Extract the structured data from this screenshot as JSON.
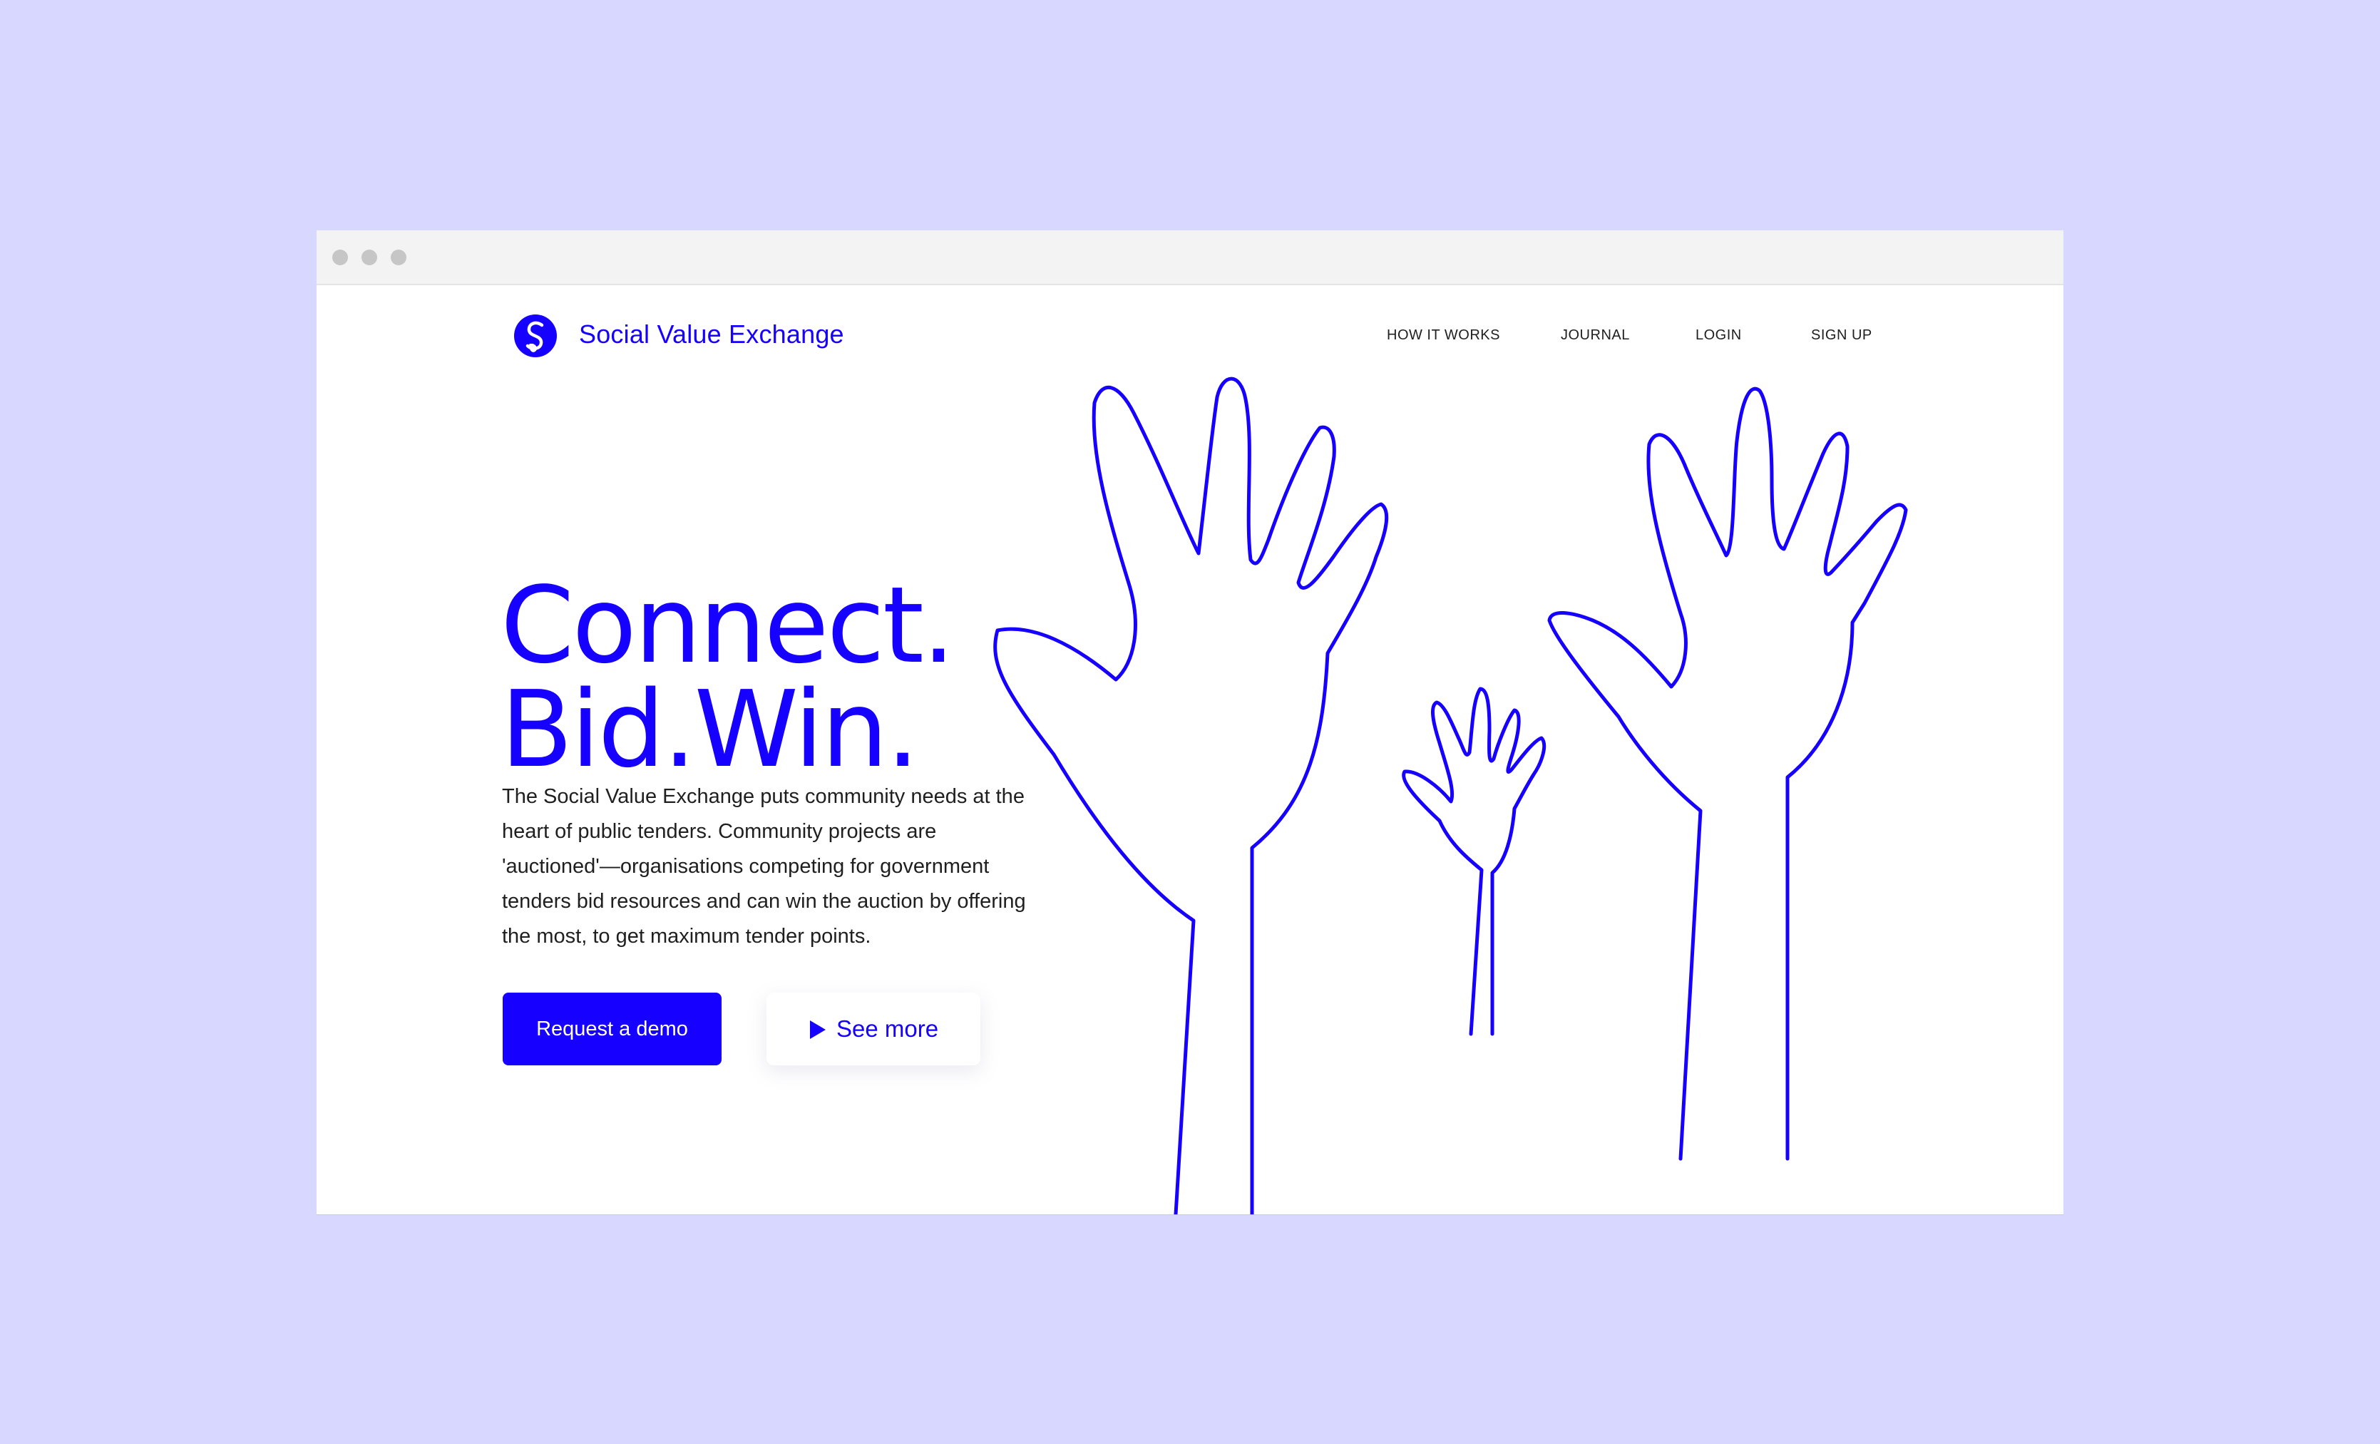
{
  "brand": {
    "name": "Social Value Exchange",
    "logo_letter": "S",
    "accent_color": "#1600ff"
  },
  "nav": {
    "items": [
      {
        "label": "HOW IT WORKS"
      },
      {
        "label": "JOURNAL"
      },
      {
        "label": "LOGIN"
      },
      {
        "label": "SIGN UP"
      }
    ]
  },
  "hero": {
    "title_line_1": "Connect.",
    "title_line_2": "Bid.Win.",
    "description": "The Social Value Exchange puts community needs at the heart of public tenders. Community projects are 'auctioned'—organisations competing for government tenders bid resources and can win the auction by offering the most, to get maximum tender points.",
    "primary_cta": "Request a demo",
    "secondary_cta": "See more"
  },
  "illustration": {
    "icon": "raised-hands-icon"
  },
  "colors": {
    "page_background": "#d8d7ff",
    "browser_chrome": "#f3f3f3",
    "text": "#1f1f1f"
  }
}
